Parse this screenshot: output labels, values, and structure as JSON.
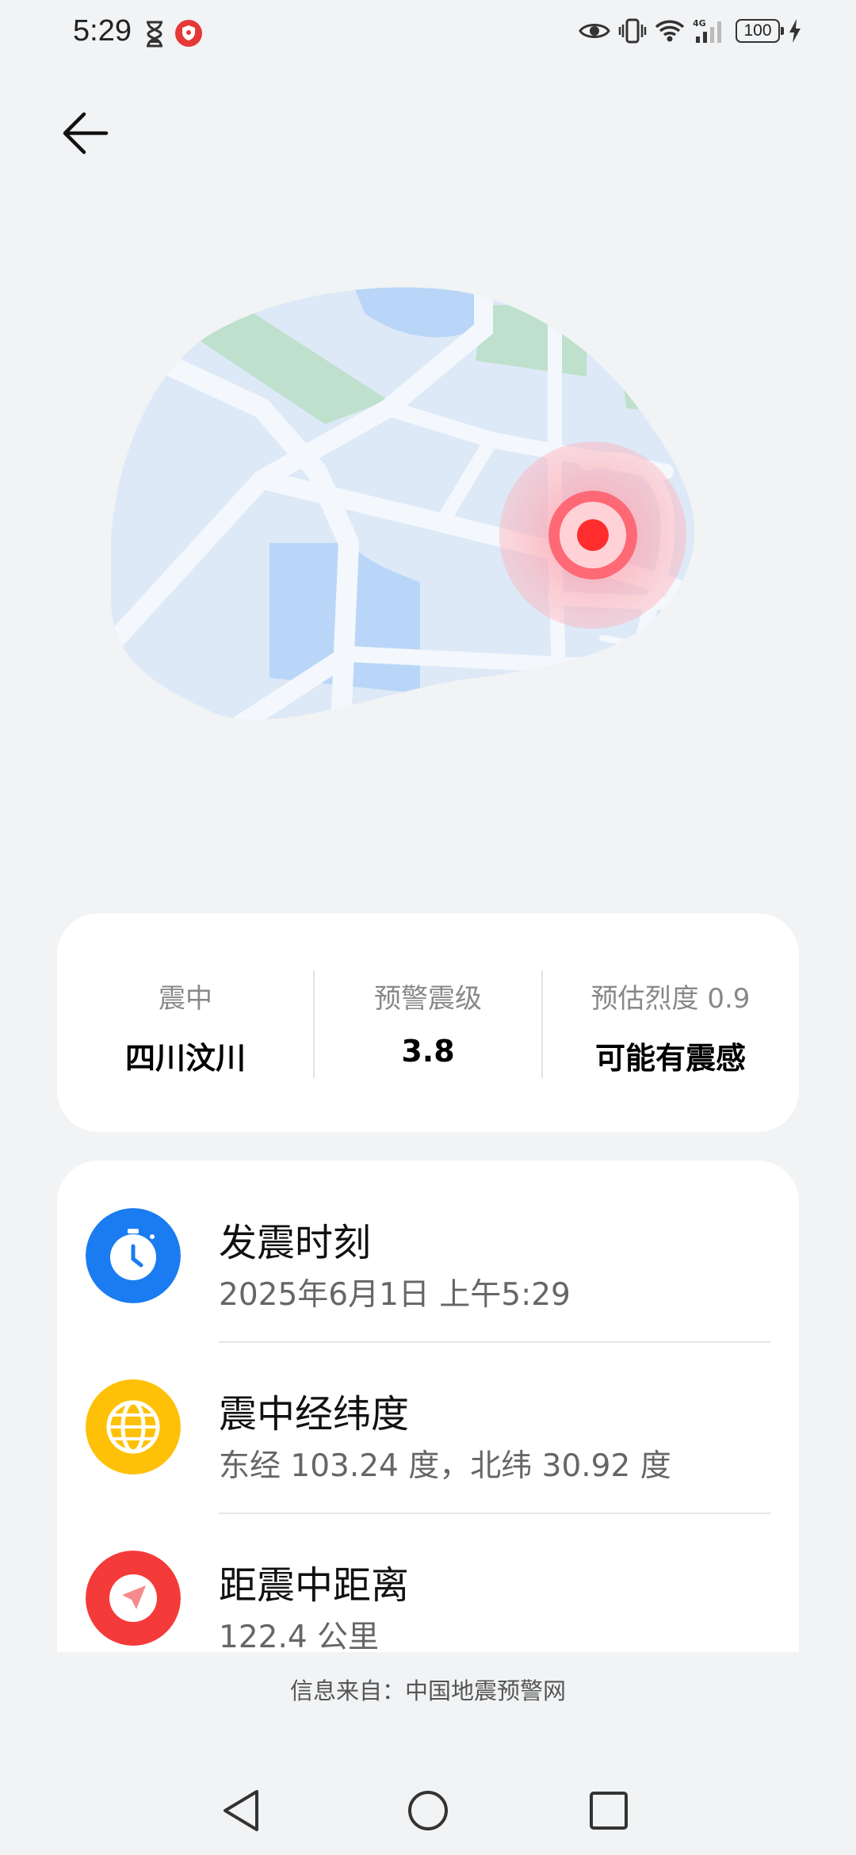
{
  "status_bar": {
    "time": "5:29",
    "battery": "100",
    "icons": [
      "hourglass-icon",
      "shield-icon",
      "eye-icon",
      "vibrate-icon",
      "wifi-icon",
      "signal-4g-icon",
      "battery-icon",
      "charging-icon"
    ]
  },
  "colors": {
    "background": "#f1f3f5",
    "epicenter_red": "#ff2d2d",
    "clock_blue": "#1a7cf0",
    "globe_yellow": "#ffc107",
    "distance_red": "#f53a3a"
  },
  "summary": {
    "epicenter_label": "震中",
    "epicenter_value": "四川汶川",
    "magnitude_label": "预警震级",
    "magnitude_value": "3.8",
    "intensity_label": "预估烈度 0.9",
    "intensity_value": "可能有震感"
  },
  "details": {
    "time_title": "发震时刻",
    "time_value": "2025年6月1日 上午5:29",
    "coords_title": "震中经纬度",
    "coords_value": "东经 103.24 度，北纬 30.92 度",
    "distance_title": "距震中距离",
    "distance_value": "122.4 公里"
  },
  "footer": {
    "source": "信息来自：中国地震预警网"
  }
}
